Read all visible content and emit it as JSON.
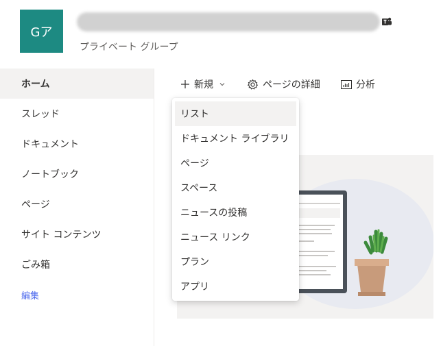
{
  "header": {
    "avatar_initials": "Gア",
    "subtitle": "プライベート グループ",
    "teams_icon": "teams-icon"
  },
  "nav": {
    "items": [
      {
        "label": "ホーム",
        "active": true
      },
      {
        "label": "スレッド"
      },
      {
        "label": "ドキュメント"
      },
      {
        "label": "ノートブック"
      },
      {
        "label": "ページ"
      },
      {
        "label": "サイト コンテンツ"
      },
      {
        "label": "ごみ箱"
      }
    ],
    "edit_label": "編集"
  },
  "commandbar": {
    "new_label": "新規",
    "page_details_label": "ページの詳細",
    "analytics_label": "分析"
  },
  "new_menu": {
    "items": [
      {
        "label": "リスト",
        "hover": true
      },
      {
        "label": "ドキュメント ライブラリ"
      },
      {
        "label": "ページ"
      },
      {
        "label": "スペース"
      },
      {
        "label": "ニュースの投稿"
      },
      {
        "label": "ニュース リンク"
      },
      {
        "label": "プラン"
      },
      {
        "label": "アプリ"
      }
    ]
  },
  "colors": {
    "avatar_bg": "#1d8a82",
    "accent": "#4f6bed"
  }
}
